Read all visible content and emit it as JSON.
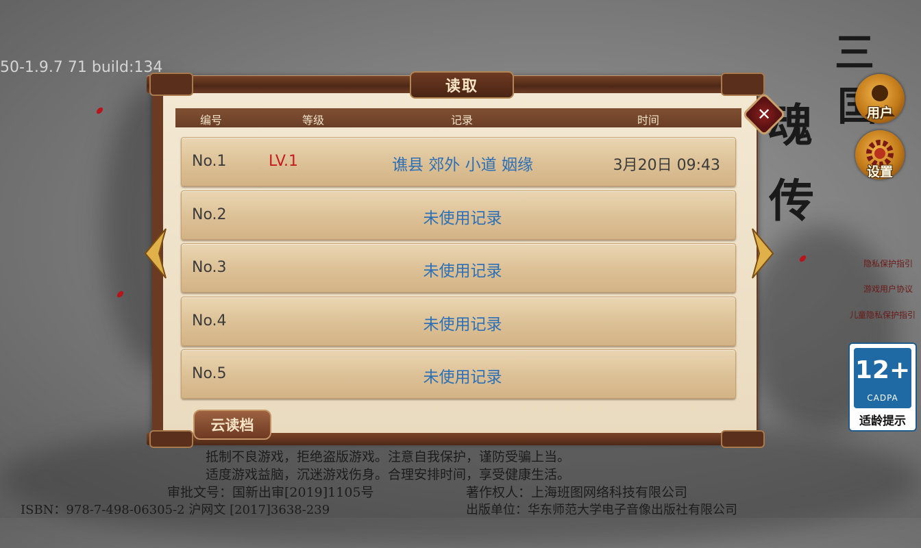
{
  "version_text": "50-1.9.7 71 build:134",
  "game_title_chars": [
    "三",
    "国",
    "魂",
    "传"
  ],
  "dialog": {
    "title": "读取",
    "headers": {
      "number": "编号",
      "level": "等级",
      "record": "记录",
      "time": "时间"
    },
    "rows": [
      {
        "number": "No.1",
        "level": "LV.1",
        "record": "谯县 郊外 小道 姻缘",
        "time": "3月20日 09:43"
      },
      {
        "number": "No.2",
        "level": "",
        "record": "未使用记录",
        "time": ""
      },
      {
        "number": "No.3",
        "level": "",
        "record": "未使用记录",
        "time": ""
      },
      {
        "number": "No.4",
        "level": "",
        "record": "未使用记录",
        "time": ""
      },
      {
        "number": "No.5",
        "level": "",
        "record": "未使用记录",
        "time": ""
      }
    ],
    "cloud_button": "云读档",
    "close_icon": "✕"
  },
  "sidebar": {
    "user_label": "用户",
    "settings_label": "设置",
    "links": [
      "隐私保护指引",
      "游戏用户协议",
      "儿童隐私保护指引"
    ]
  },
  "age_rating": {
    "number": "12+",
    "org": "CADPA",
    "tip": "适龄提示"
  },
  "footer": {
    "line1": "抵制不良游戏，拒绝盗版游戏。注意自我保护，谨防受骗上当。",
    "line2": "适度游戏益脑，沉迷游戏伤身。合理安排时间，享受健康生活。",
    "line3_left": "审批文号：国新出审[2019]1105号",
    "line3_right": "著作权人：上海班图网络科技有限公司",
    "line4_left": "ISBN：978-7-498-06305-2 沪网文 [2017]3638-239",
    "line4_right": "出版单位：华东师范大学电子音像出版社有限公司"
  },
  "colors": {
    "frame": "#6b3a22",
    "paper": "#f3e8d3",
    "record_blue": "#2d6fb5",
    "level_red": "#c71b1b"
  }
}
